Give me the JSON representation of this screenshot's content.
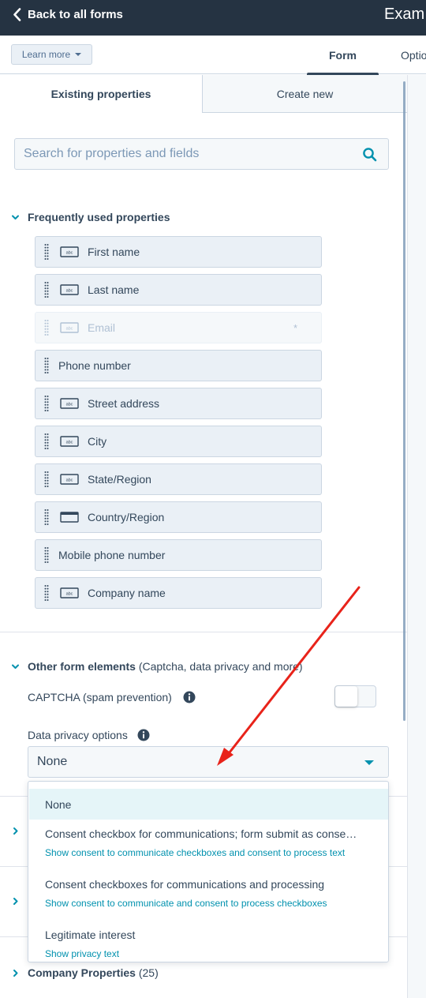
{
  "header": {
    "back_label": "Back to all forms",
    "form_title": "Exam"
  },
  "subbar": {
    "learn_more": "Learn more",
    "tabs": [
      {
        "label": "Form",
        "active": true
      },
      {
        "label": "Optio",
        "active": false
      }
    ]
  },
  "panel": {
    "tabs": [
      {
        "label": "Existing properties",
        "active": true
      },
      {
        "label": "Create new",
        "active": false
      }
    ],
    "search_placeholder": "Search for properties and fields",
    "frequent": {
      "title": "Frequently used properties",
      "items": [
        {
          "label": "First name",
          "icon": "text-field-icon",
          "disabled": false
        },
        {
          "label": "Last name",
          "icon": "text-field-icon",
          "disabled": false
        },
        {
          "label": "Email",
          "icon": "text-field-icon",
          "disabled": true,
          "required": "*"
        },
        {
          "label": "Phone number",
          "icon": "",
          "disabled": false
        },
        {
          "label": "Street address",
          "icon": "text-field-icon",
          "disabled": false
        },
        {
          "label": "City",
          "icon": "text-field-icon",
          "disabled": false
        },
        {
          "label": "State/Region",
          "icon": "text-field-icon",
          "disabled": false
        },
        {
          "label": "Country/Region",
          "icon": "dropdown-field-icon",
          "disabled": false
        },
        {
          "label": "Mobile phone number",
          "icon": "",
          "disabled": false
        },
        {
          "label": "Company name",
          "icon": "text-field-icon",
          "disabled": false
        }
      ]
    },
    "other": {
      "title": "Other form elements",
      "subtitle": "(Captcha, data privacy and more)",
      "captcha_label": "CAPTCHA (spam prevention)",
      "captcha_enabled": false,
      "privacy_label": "Data privacy options",
      "privacy_selected": "None",
      "privacy_options": [
        {
          "label": "None",
          "desc": ""
        },
        {
          "label": "Consent checkbox for communications; form submit as conse…",
          "desc": "Show consent to communicate checkboxes and consent to process text"
        },
        {
          "label": "Consent checkboxes for communications and processing",
          "desc": "Show consent to communicate and consent to process checkboxes"
        },
        {
          "label": "Legitimate interest",
          "desc": "Show privacy text"
        }
      ]
    },
    "company": {
      "title": "Company Properties",
      "count": "(25)"
    }
  },
  "colors": {
    "header_bg": "#253342",
    "accent": "#0091ae",
    "annotation_arrow": "#e8231a"
  }
}
